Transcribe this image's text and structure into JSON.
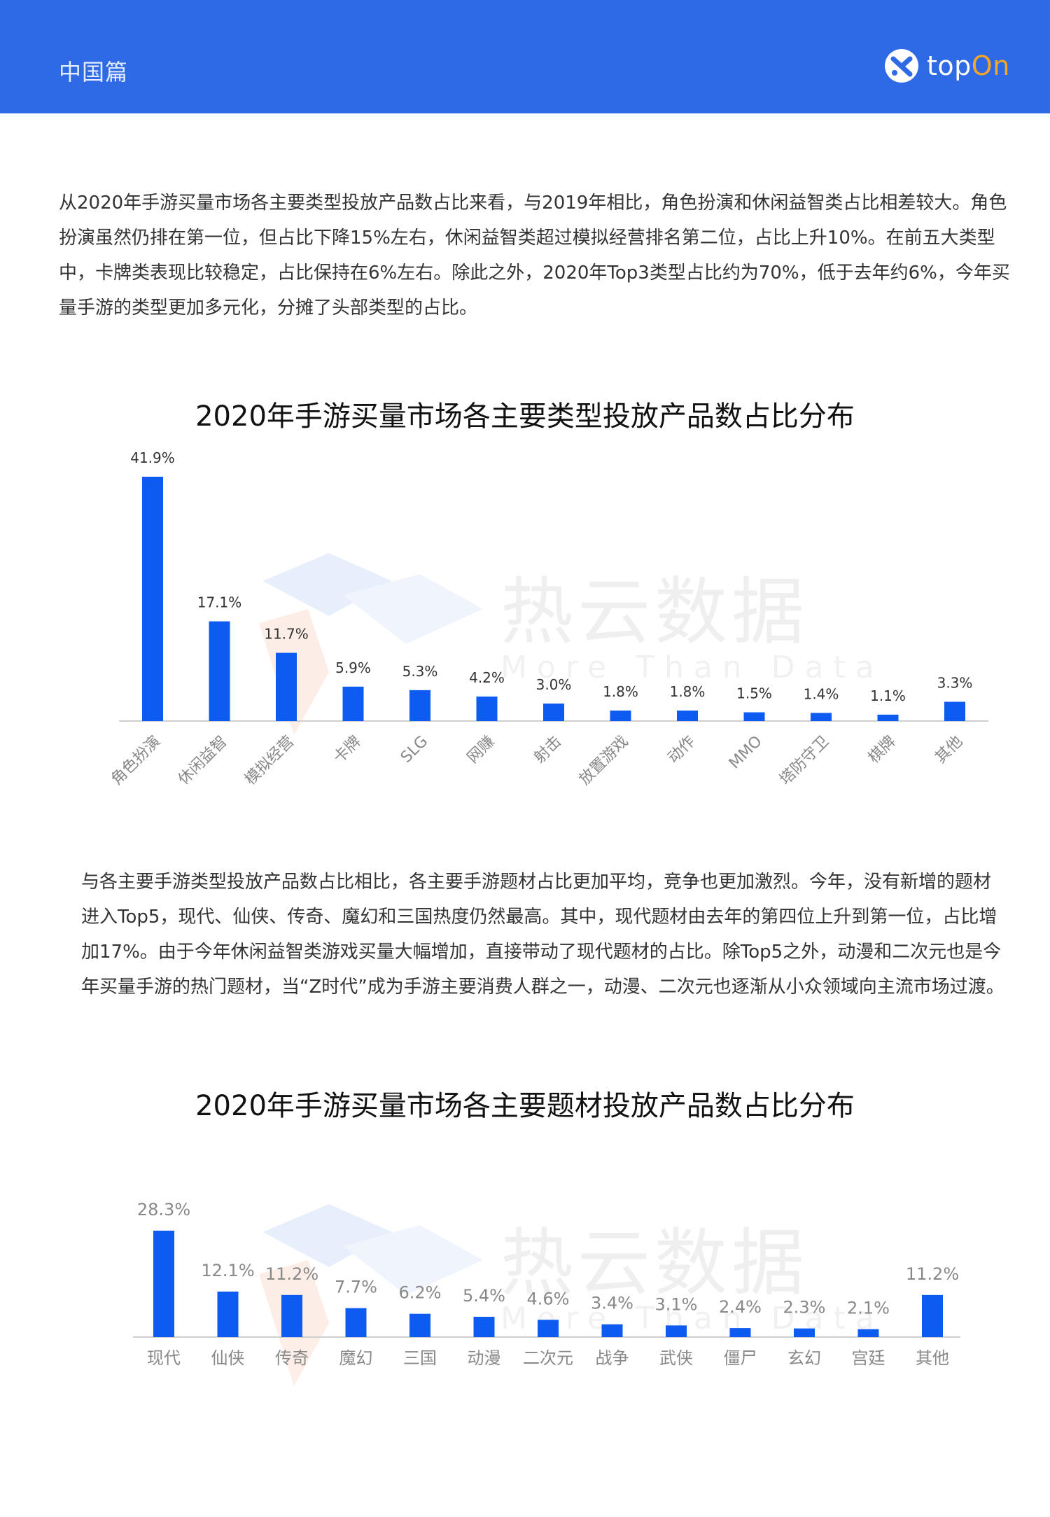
{
  "header": {
    "section": "中国篇",
    "brand_top": "top",
    "brand_on": "On",
    "brand_color": "#2f6ae6",
    "brand_accent": "#f5a623",
    "logo_icon": "topon-logo-icon"
  },
  "paragraph1": "从2020年手游买量市场各主要类型投放产品数占比来看，与2019年相比，角色扮演和休闲益智类占比相差较大。角色扮演虽然仍排在第一位，但占比下降15%左右，休闲益智类超过模拟经营排名第二位，占比上升10%。在前五大类型中，卡牌类表现比较稳定，占比保持在6%左右。除此之外，2020年Top3类型占比约为70%，低于去年约6%，今年买量手游的类型更加多元化，分摊了头部类型的占比。",
  "paragraph2": "与各主要手游类型投放产品数占比相比，各主要手游题材占比更加平均，竞争也更加激烈。今年，没有新增的题材进入Top5，现代、仙侠、传奇、魔幻和三国热度仍然最高。其中，现代题材由去年的第四位上升到第一位，占比增加17%。由于今年休闲益智类游戏买量大幅增加，直接带动了现代题材的占比。除Top5之外，动漫和二次元也是今年买量手游的热门题材，当“Z时代”成为手游主要消费人群之一，动漫、二次元也逐渐从小众领域向主流市场过渡。",
  "watermark": {
    "cn": "热云数据",
    "en": "More Than Data"
  },
  "chart_data": [
    {
      "type": "bar",
      "title": "2020年手游买量市场各主要类型投放产品数占比分布",
      "categories": [
        "角色扮演",
        "休闲益智",
        "模拟经营",
        "卡牌",
        "SLG",
        "网赚",
        "射击",
        "放置游戏",
        "动作",
        "MMO",
        "塔防守卫",
        "棋牌",
        "其他"
      ],
      "values": [
        41.9,
        17.1,
        11.7,
        5.9,
        5.3,
        4.2,
        3.0,
        1.8,
        1.8,
        1.5,
        1.4,
        1.1,
        3.3
      ],
      "labels": [
        "41.9%",
        "17.1%",
        "11.7%",
        "5.9%",
        "5.3%",
        "4.2%",
        "3.0%",
        "1.8%",
        "1.8%",
        "1.5%",
        "1.4%",
        "1.1%",
        "3.3%"
      ],
      "unit": "%",
      "bar_color": "#0d5bf0",
      "ylim": [
        0,
        41.9
      ],
      "rotated_labels": true,
      "grid": false,
      "legend": "none"
    },
    {
      "type": "bar",
      "title": "2020年手游买量市场各主要题材投放产品数占比分布",
      "categories": [
        "现代",
        "仙侠",
        "传奇",
        "魔幻",
        "三国",
        "动漫",
        "二次元",
        "战争",
        "武侠",
        "僵尸",
        "玄幻",
        "宫廷",
        "其他"
      ],
      "values": [
        28.3,
        12.1,
        11.2,
        7.7,
        6.2,
        5.4,
        4.6,
        3.4,
        3.1,
        2.4,
        2.3,
        2.1,
        11.2
      ],
      "labels": [
        "28.3%",
        "12.1%",
        "11.2%",
        "7.7%",
        "6.2%",
        "5.4%",
        "4.6%",
        "3.4%",
        "3.1%",
        "2.4%",
        "2.3%",
        "2.1%",
        "11.2%"
      ],
      "unit": "%",
      "bar_color": "#0d5bf0",
      "ylim": [
        0,
        28.3
      ],
      "rotated_labels": false,
      "grid": false,
      "legend": "none"
    }
  ]
}
